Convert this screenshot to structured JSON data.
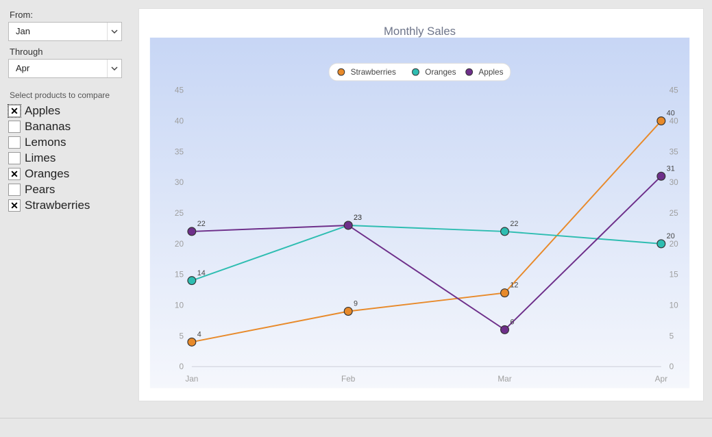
{
  "filters": {
    "from_label": "From:",
    "from_value": "Jan",
    "through_label": "Through",
    "through_value": "Apr",
    "compare_label": "Select products to compare",
    "products": [
      {
        "name": "Apples",
        "checked": true,
        "focused": true
      },
      {
        "name": "Bananas",
        "checked": false,
        "focused": false
      },
      {
        "name": "Lemons",
        "checked": false,
        "focused": false
      },
      {
        "name": "Limes",
        "checked": false,
        "focused": false
      },
      {
        "name": "Oranges",
        "checked": true,
        "focused": false
      },
      {
        "name": "Pears",
        "checked": false,
        "focused": false
      },
      {
        "name": "Strawberries",
        "checked": true,
        "focused": false
      }
    ]
  },
  "chart_data": {
    "type": "line",
    "title": "Monthly Sales",
    "categories": [
      "Jan",
      "Feb",
      "Mar",
      "Apr"
    ],
    "ylim": [
      0,
      45
    ],
    "ytick_step": 5,
    "series": [
      {
        "name": "Strawberries",
        "color": "#e88a2a",
        "values": [
          4,
          9,
          12,
          40
        ]
      },
      {
        "name": "Oranges",
        "color": "#2ebdb1",
        "values": [
          14,
          23,
          22,
          20
        ]
      },
      {
        "name": "Apples",
        "color": "#6e2f8a",
        "values": [
          22,
          23,
          6,
          31
        ]
      }
    ]
  }
}
